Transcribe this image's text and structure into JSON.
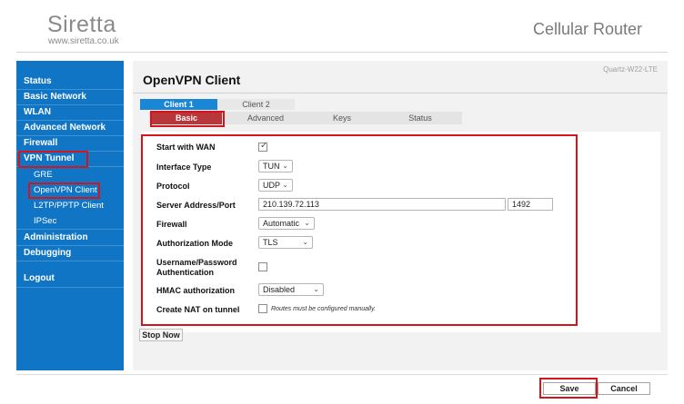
{
  "header": {
    "brand_name": "Siretta",
    "brand_url": "www.siretta.co.uk",
    "product_title": "Cellular Router"
  },
  "sidebar": {
    "items": [
      {
        "label": "Status"
      },
      {
        "label": "Basic Network"
      },
      {
        "label": "WLAN"
      },
      {
        "label": "Advanced Network"
      },
      {
        "label": "Firewall"
      },
      {
        "label": "VPN Tunnel",
        "selected": true
      },
      {
        "label": "GRE"
      },
      {
        "label": "OpenVPN Client",
        "selected": true
      },
      {
        "label": "L2TP/PPTP Client"
      },
      {
        "label": "IPSec"
      },
      {
        "label": "Administration"
      },
      {
        "label": "Debugging"
      },
      {
        "label": "Logout"
      }
    ]
  },
  "main": {
    "model": "Quartz-W22-LTE",
    "page_title": "OpenVPN Client",
    "client_tabs": [
      {
        "label": "Client 1",
        "active": true
      },
      {
        "label": "Client 2",
        "active": false
      }
    ],
    "sub_tabs": [
      {
        "label": "Basic",
        "active": true
      },
      {
        "label": "Advanced",
        "active": false
      },
      {
        "label": "Keys",
        "active": false
      },
      {
        "label": "Status",
        "active": false
      }
    ],
    "form": {
      "start_with_wan": {
        "label": "Start with WAN",
        "checked": true
      },
      "interface_type": {
        "label": "Interface Type",
        "value": "TUN"
      },
      "protocol": {
        "label": "Protocol",
        "value": "UDP"
      },
      "server": {
        "label": "Server Address/Port",
        "address": "210.139.72.113",
        "port": "1492"
      },
      "firewall": {
        "label": "Firewall",
        "value": "Automatic"
      },
      "auth_mode": {
        "label": "Authorization Mode",
        "value": "TLS"
      },
      "user_pass": {
        "label_line1": "Username/Password",
        "label_line2": "Authentication",
        "checked": false
      },
      "hmac": {
        "label": "HMAC authorization",
        "value": "Disabled"
      },
      "nat": {
        "label": "Create NAT on tunnel",
        "checked": false,
        "hint": "Routes must be configured manually."
      }
    },
    "stop_button": "Stop Now"
  },
  "footer": {
    "save_label": "Save",
    "cancel_label": "Cancel"
  },
  "colors": {
    "sidebar_bg": "#1175c6",
    "active_tab": "#1a86d6",
    "active_subtab": "#b9363a",
    "highlight": "#d4161c"
  },
  "icons": {
    "checkbox_tick": "checkmark-icon",
    "dropdown": "chevron-down-icon"
  }
}
